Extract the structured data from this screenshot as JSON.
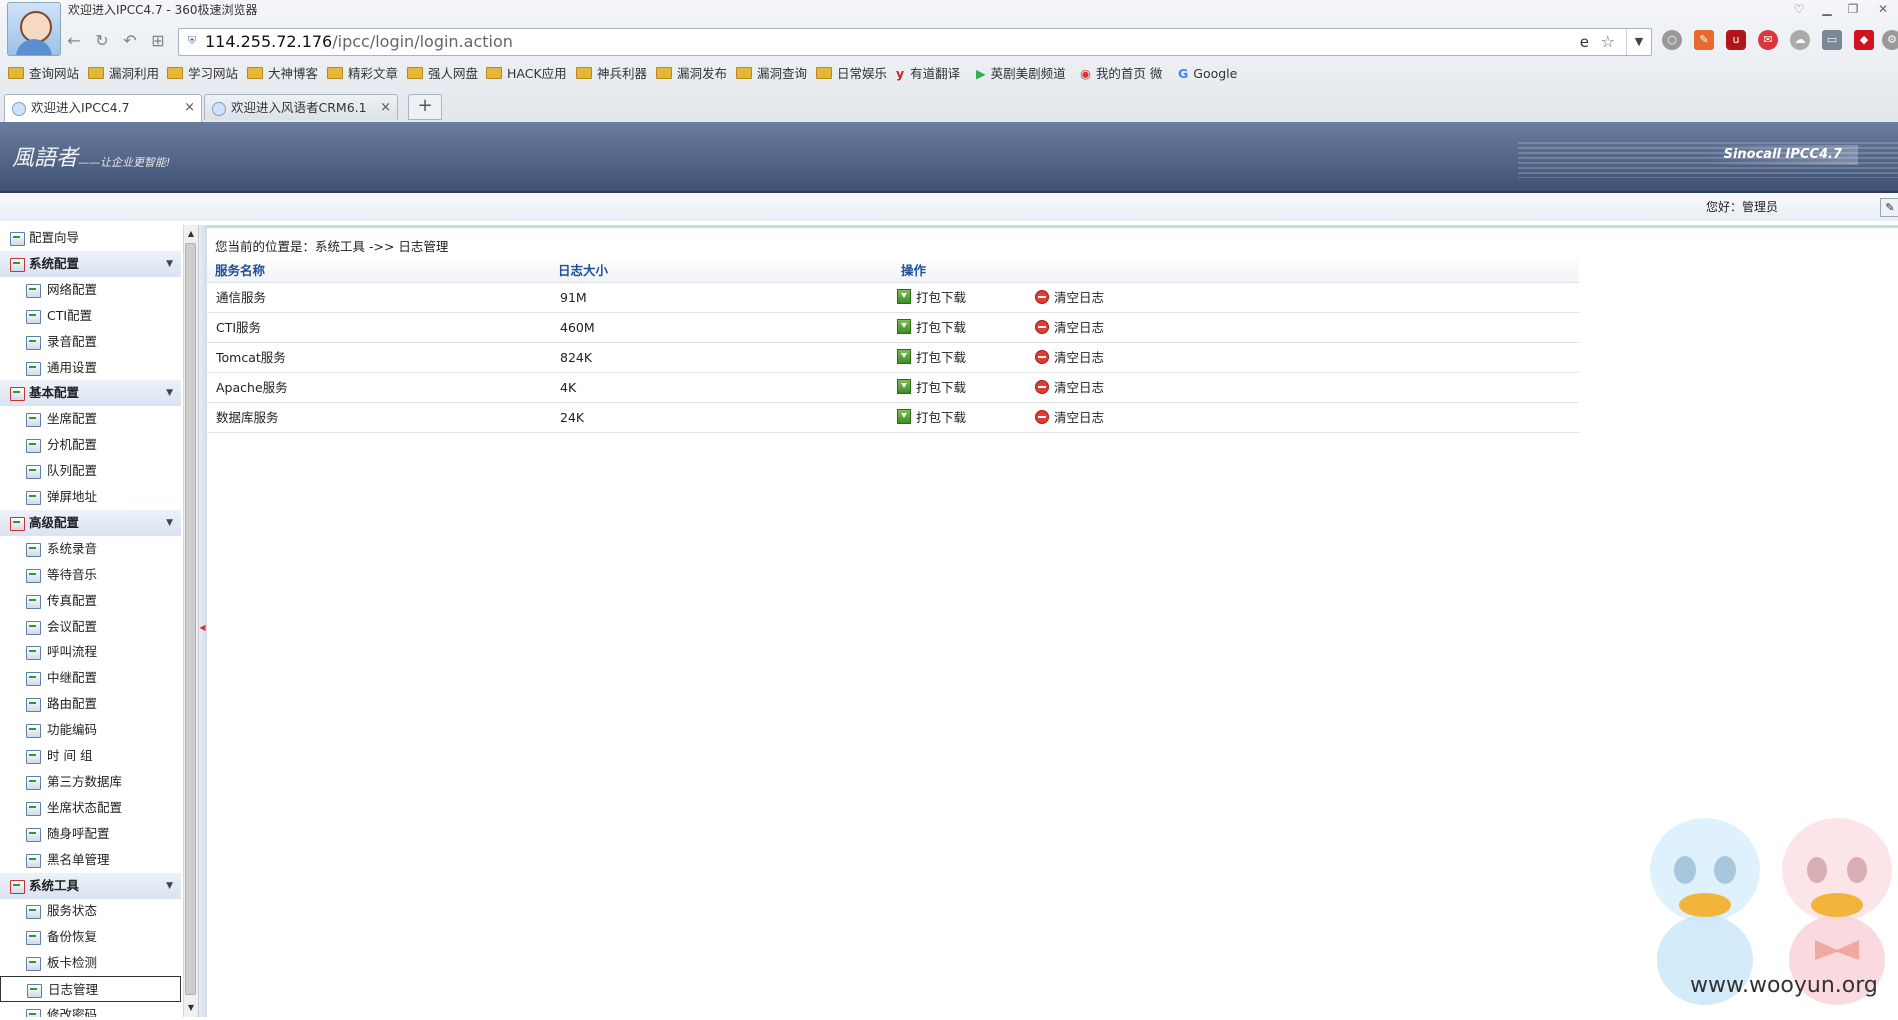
{
  "window": {
    "title": "欢迎进入IPCC4.7 - 360极速浏览器"
  },
  "address": {
    "url_host": "114.255.72.176",
    "url_path": "/ipcc/login/login.action"
  },
  "bookmarks": [
    {
      "label": "查询网站",
      "type": "folder"
    },
    {
      "label": "漏洞利用",
      "type": "folder"
    },
    {
      "label": "学习网站",
      "type": "folder"
    },
    {
      "label": "大神博客",
      "type": "folder"
    },
    {
      "label": "精彩文章",
      "type": "folder"
    },
    {
      "label": "强人网盘",
      "type": "folder"
    },
    {
      "label": "HACK应用",
      "type": "folder"
    },
    {
      "label": "神兵利器",
      "type": "folder"
    },
    {
      "label": "漏洞发布",
      "type": "folder"
    },
    {
      "label": "漏洞查询",
      "type": "folder"
    },
    {
      "label": "日常娱乐",
      "type": "folder"
    },
    {
      "label": "有道翻译",
      "type": "youdao"
    },
    {
      "label": "英剧美剧频道",
      "type": "play"
    },
    {
      "label": "我的首页 微",
      "type": "weibo"
    },
    {
      "label": "Google",
      "type": "google"
    }
  ],
  "tabs": [
    {
      "label": "欢迎进入IPCC4.7",
      "active": true
    },
    {
      "label": "欢迎进入风语者CRM6.1",
      "active": false
    }
  ],
  "banner": {
    "logo": "風語者",
    "slogan": "——让企业更智能!",
    "product": "Sinocall  IPCC4.7"
  },
  "user": {
    "greeting": "您好：管理员"
  },
  "sidebar": {
    "items": [
      {
        "label": "配置向导",
        "kind": "top"
      },
      {
        "label": "系统配置",
        "kind": "group"
      },
      {
        "label": "网络配置",
        "kind": "sub"
      },
      {
        "label": "CTI配置",
        "kind": "sub"
      },
      {
        "label": "录音配置",
        "kind": "sub"
      },
      {
        "label": "通用设置",
        "kind": "sub"
      },
      {
        "label": "基本配置",
        "kind": "group"
      },
      {
        "label": "坐席配置",
        "kind": "sub"
      },
      {
        "label": "分机配置",
        "kind": "sub"
      },
      {
        "label": "队列配置",
        "kind": "sub"
      },
      {
        "label": "弹屏地址",
        "kind": "sub"
      },
      {
        "label": "高级配置",
        "kind": "group"
      },
      {
        "label": "系统录音",
        "kind": "sub"
      },
      {
        "label": "等待音乐",
        "kind": "sub"
      },
      {
        "label": "传真配置",
        "kind": "sub"
      },
      {
        "label": "会议配置",
        "kind": "sub"
      },
      {
        "label": "呼叫流程",
        "kind": "sub"
      },
      {
        "label": "中继配置",
        "kind": "sub"
      },
      {
        "label": "路由配置",
        "kind": "sub"
      },
      {
        "label": "功能编码",
        "kind": "sub"
      },
      {
        "label": "时 间 组",
        "kind": "sub"
      },
      {
        "label": "第三方数据库",
        "kind": "sub"
      },
      {
        "label": "坐席状态配置",
        "kind": "sub"
      },
      {
        "label": "随身呼配置",
        "kind": "sub"
      },
      {
        "label": "黑名单管理",
        "kind": "sub"
      },
      {
        "label": "系统工具",
        "kind": "group"
      },
      {
        "label": "服务状态",
        "kind": "sub"
      },
      {
        "label": "备份恢复",
        "kind": "sub"
      },
      {
        "label": "板卡检测",
        "kind": "sub"
      },
      {
        "label": "日志管理",
        "kind": "sub",
        "active": true
      },
      {
        "label": "修改密码",
        "kind": "sub"
      }
    ]
  },
  "main": {
    "breadcrumb": "您当前的位置是：系统工具 ->> 日志管理",
    "table": {
      "headers": [
        "服务名称",
        "日志大小",
        "操作"
      ],
      "download_label": "打包下载",
      "clear_label": "清空日志",
      "rows": [
        {
          "name": "通信服务",
          "size": "91M"
        },
        {
          "name": "CTI服务",
          "size": "460M"
        },
        {
          "name": "Tomcat服务",
          "size": "824K"
        },
        {
          "name": "Apache服务",
          "size": "4K"
        },
        {
          "name": "数据库服务",
          "size": "24K"
        }
      ]
    }
  },
  "watermark": "www.wooyun.org"
}
